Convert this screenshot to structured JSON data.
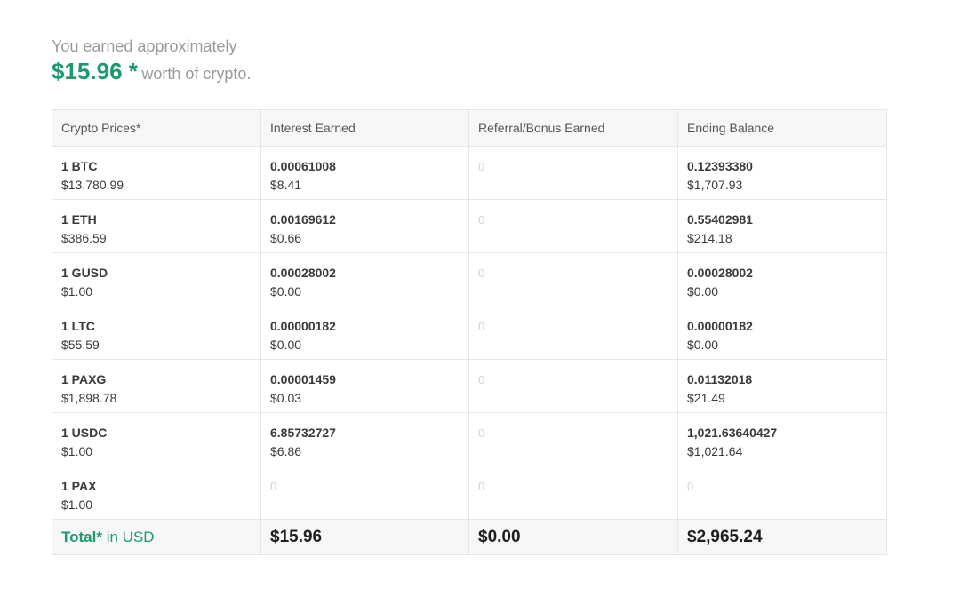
{
  "summary": {
    "intro": "You earned approximately",
    "amount": "$15.96 *",
    "suffix": "worth of crypto."
  },
  "table": {
    "headers": [
      "Crypto Prices*",
      "Interest Earned",
      "Referral/Bonus Earned",
      "Ending Balance"
    ],
    "rows": [
      {
        "asset": "1 BTC",
        "price": "$13,780.99",
        "interest_crypto": "0.00061008",
        "interest_usd": "$8.41",
        "bonus": "0",
        "balance_crypto": "0.12393380",
        "balance_usd": "$1,707.93"
      },
      {
        "asset": "1 ETH",
        "price": "$386.59",
        "interest_crypto": "0.00169612",
        "interest_usd": "$0.66",
        "bonus": "0",
        "balance_crypto": "0.55402981",
        "balance_usd": "$214.18"
      },
      {
        "asset": "1 GUSD",
        "price": "$1.00",
        "interest_crypto": "0.00028002",
        "interest_usd": "$0.00",
        "bonus": "0",
        "balance_crypto": "0.00028002",
        "balance_usd": "$0.00"
      },
      {
        "asset": "1 LTC",
        "price": "$55.59",
        "interest_crypto": "0.00000182",
        "interest_usd": "$0.00",
        "bonus": "0",
        "balance_crypto": "0.00000182",
        "balance_usd": "$0.00"
      },
      {
        "asset": "1 PAXG",
        "price": "$1,898.78",
        "interest_crypto": "0.00001459",
        "interest_usd": "$0.03",
        "bonus": "0",
        "balance_crypto": "0.01132018",
        "balance_usd": "$21.49"
      },
      {
        "asset": "1 USDC",
        "price": "$1.00",
        "interest_crypto": "6.85732727",
        "interest_usd": "$6.86",
        "bonus": "0",
        "balance_crypto": "1,021.63640427",
        "balance_usd": "$1,021.64"
      },
      {
        "asset": "1 PAX",
        "price": "$1.00",
        "interest_zero": "0",
        "bonus": "0",
        "balance_zero": "0"
      }
    ],
    "total": {
      "label_bold": "Total*",
      "label_rest": " in USD",
      "interest": "$15.96",
      "bonus": "$0.00",
      "balance": "$2,965.24"
    }
  },
  "colors": {
    "accent": "#1e9a6c",
    "muted_text": "#9a9a9a",
    "zero_text": "#d2d2d2",
    "header_bg": "#f7f7f7",
    "border": "#e6e6e6"
  }
}
